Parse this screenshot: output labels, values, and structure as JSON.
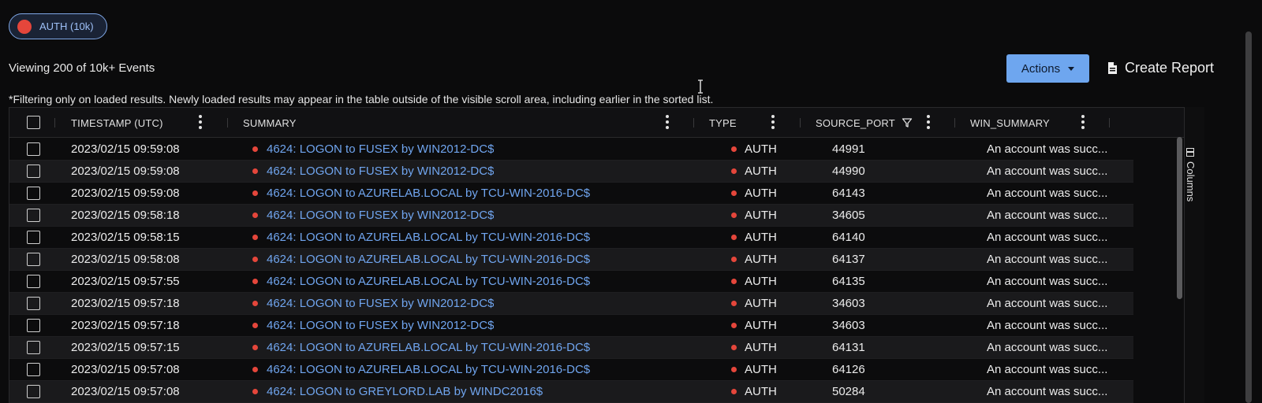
{
  "filter_chip": {
    "label": "AUTH (10k)",
    "color": "#e5463b"
  },
  "viewing_text": "Viewing 200 of 10k+ Events",
  "toolbar": {
    "actions_label": "Actions",
    "create_report_label": "Create Report",
    "accent": "#6ea6ef"
  },
  "filter_note": "*Filtering only on loaded results.  Newly loaded results may appear in the table outside of the visible scroll area, including earlier in the sorted list.",
  "table": {
    "columns": [
      {
        "key": "timestamp",
        "label": "TIMESTAMP (UTC)"
      },
      {
        "key": "summary",
        "label": "SUMMARY"
      },
      {
        "key": "type",
        "label": "TYPE"
      },
      {
        "key": "source_port",
        "label": "SOURCE_PORT",
        "filtered": true
      },
      {
        "key": "win_summary",
        "label": "WIN_SUMMARY"
      }
    ],
    "rows": [
      {
        "timestamp": "2023/02/15 09:59:08",
        "summary": "4624: LOGON to FUSEX by WIN2012-DC$",
        "type": "AUTH",
        "source_port": "44991",
        "win_summary": "An account was succ..."
      },
      {
        "timestamp": "2023/02/15 09:59:08",
        "summary": "4624: LOGON to FUSEX by WIN2012-DC$",
        "type": "AUTH",
        "source_port": "44990",
        "win_summary": "An account was succ..."
      },
      {
        "timestamp": "2023/02/15 09:59:08",
        "summary": "4624: LOGON to AZURELAB.LOCAL by TCU-WIN-2016-DC$",
        "type": "AUTH",
        "source_port": "64143",
        "win_summary": "An account was succ..."
      },
      {
        "timestamp": "2023/02/15 09:58:18",
        "summary": "4624: LOGON to FUSEX by WIN2012-DC$",
        "type": "AUTH",
        "source_port": "34605",
        "win_summary": "An account was succ..."
      },
      {
        "timestamp": "2023/02/15 09:58:15",
        "summary": "4624: LOGON to AZURELAB.LOCAL by TCU-WIN-2016-DC$",
        "type": "AUTH",
        "source_port": "64140",
        "win_summary": "An account was succ..."
      },
      {
        "timestamp": "2023/02/15 09:58:08",
        "summary": "4624: LOGON to AZURELAB.LOCAL by TCU-WIN-2016-DC$",
        "type": "AUTH",
        "source_port": "64137",
        "win_summary": "An account was succ..."
      },
      {
        "timestamp": "2023/02/15 09:57:55",
        "summary": "4624: LOGON to AZURELAB.LOCAL by TCU-WIN-2016-DC$",
        "type": "AUTH",
        "source_port": "64135",
        "win_summary": "An account was succ..."
      },
      {
        "timestamp": "2023/02/15 09:57:18",
        "summary": "4624: LOGON to FUSEX by WIN2012-DC$",
        "type": "AUTH",
        "source_port": "34603",
        "win_summary": "An account was succ..."
      },
      {
        "timestamp": "2023/02/15 09:57:18",
        "summary": "4624: LOGON to FUSEX by WIN2012-DC$",
        "type": "AUTH",
        "source_port": "34603",
        "win_summary": "An account was succ..."
      },
      {
        "timestamp": "2023/02/15 09:57:15",
        "summary": "4624: LOGON to AZURELAB.LOCAL by TCU-WIN-2016-DC$",
        "type": "AUTH",
        "source_port": "64131",
        "win_summary": "An account was succ..."
      },
      {
        "timestamp": "2023/02/15 09:57:08",
        "summary": "4624: LOGON to AZURELAB.LOCAL by TCU-WIN-2016-DC$",
        "type": "AUTH",
        "source_port": "64126",
        "win_summary": "An account was succ..."
      },
      {
        "timestamp": "2023/02/15 09:57:08",
        "summary": "4624: LOGON to GREYLORD.LAB by WINDC2016$",
        "type": "AUTH",
        "source_port": "50284",
        "win_summary": "An account was succ..."
      }
    ]
  },
  "side_panel": {
    "columns_label": "Columns"
  }
}
